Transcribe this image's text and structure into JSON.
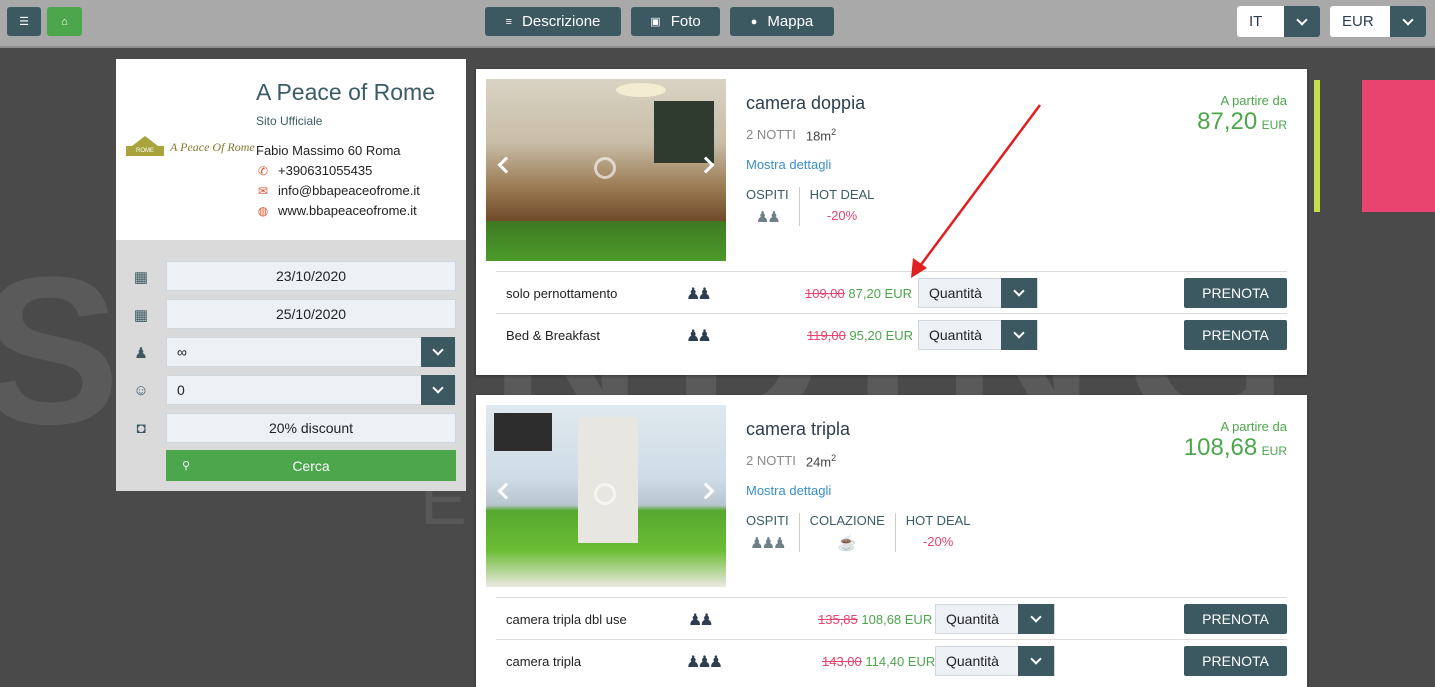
{
  "topbar": {
    "descrizione_label": "Descrizione",
    "foto_label": "Foto",
    "mappa_label": "Mappa",
    "lang_value": "IT",
    "currency_value": "EUR"
  },
  "hotel": {
    "logo_text": "A Peace Of Rome",
    "logo_badge": "ROME",
    "name": "A Peace of Rome",
    "subtitle": "Sito Ufficiale",
    "address": "Fabio Massimo 60 Roma",
    "phone": "+390631055435",
    "email": "info@bbapeaceofrome.it",
    "website": "www.bbapeaceofrome.it"
  },
  "search": {
    "checkin": "23/10/2020",
    "checkout": "25/10/2020",
    "adults": "∞",
    "children": "0",
    "promo": "20% discount",
    "button_label": "Cerca"
  },
  "rooms": [
    {
      "title": "camera doppia",
      "nights": "2 NOTTI",
      "size": "18m",
      "size_exp": "2",
      "more_label": "Mostra dettagli",
      "feat_guests": "OSPITI",
      "feat_deal": "HOT DEAL",
      "deal_value": "-20%",
      "from_label": "A partire da",
      "from_price": "87,20",
      "from_currency": "EUR",
      "rates": [
        {
          "name": "solo pernottamento",
          "old": "109,00",
          "new": "87,20 EUR",
          "qty": "Quantità",
          "book": "PRENOTA"
        },
        {
          "name": "Bed & Breakfast",
          "old": "119,00",
          "new": "95,20 EUR",
          "qty": "Quantità",
          "book": "PRENOTA"
        }
      ]
    },
    {
      "title": "camera tripla",
      "nights": "2 NOTTI",
      "size": "24m",
      "size_exp": "2",
      "more_label": "Mostra dettagli",
      "feat_guests": "OSPITI",
      "feat_breakfast": "COLAZIONE",
      "feat_deal": "HOT DEAL",
      "deal_value": "-20%",
      "from_label": "A partire da",
      "from_price": "108,68",
      "from_currency": "EUR",
      "rates": [
        {
          "name": "camera tripla dbl use",
          "old": "135,85",
          "new": "108,68 EUR",
          "qty": "Quantità",
          "book": "PRENOTA"
        },
        {
          "name": "camera tripla",
          "old": "143,00",
          "new": "114,40 EUR",
          "qty": "Quantità",
          "book": "PRENOTA"
        }
      ]
    }
  ],
  "icons": {
    "menu": "menu-icon",
    "home": "home-icon",
    "calendar_in": "calendar-check-icon",
    "calendar_out": "calendar-x-icon",
    "adult": "adult-icon",
    "child": "child-icon",
    "gift": "gift-icon",
    "search": "search-icon"
  },
  "colors": {
    "primary": "#3c5962",
    "green": "#4ca64c",
    "discount": "#e8446f",
    "link": "#3a8fc6",
    "annotation": "#e02020"
  }
}
